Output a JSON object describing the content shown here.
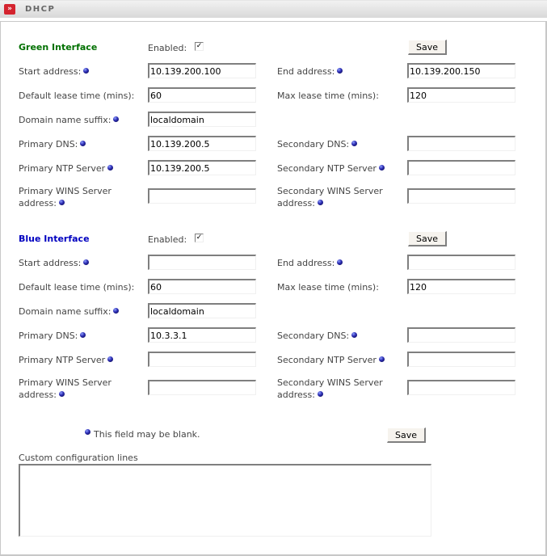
{
  "window": {
    "title": "DHCP",
    "icon": "double-chevron-right-icon"
  },
  "common": {
    "enabled_label": "Enabled:",
    "save_label": "Save"
  },
  "green": {
    "heading": "Green Interface",
    "color": "#007000",
    "enabled": true,
    "start_address": {
      "label": "Start address:",
      "value": "10.139.200.100"
    },
    "end_address": {
      "label": "End address:",
      "value": "10.139.200.150"
    },
    "default_lease": {
      "label": "Default lease time (mins):",
      "value": "60"
    },
    "max_lease": {
      "label": "Max lease time (mins):",
      "value": "120"
    },
    "domain_suffix": {
      "label": "Domain name suffix:",
      "value": "localdomain"
    },
    "primary_dns": {
      "label": "Primary DNS:",
      "value": "10.139.200.5"
    },
    "secondary_dns": {
      "label": "Secondary DNS:",
      "value": ""
    },
    "primary_ntp": {
      "label": "Primary NTP Server",
      "value": "10.139.200.5"
    },
    "secondary_ntp": {
      "label": "Secondary NTP Server",
      "value": ""
    },
    "primary_wins": {
      "label_line1": "Primary WINS Server",
      "label_line2": "address:",
      "value": ""
    },
    "secondary_wins": {
      "label_line1": "Secondary WINS Server",
      "label_line2": "address:",
      "value": ""
    }
  },
  "blue": {
    "heading": "Blue Interface",
    "color": "#0000c0",
    "enabled": true,
    "start_address": {
      "label": "Start address:",
      "value": ""
    },
    "end_address": {
      "label": "End address:",
      "value": ""
    },
    "default_lease": {
      "label": "Default lease time (mins):",
      "value": "60"
    },
    "max_lease": {
      "label": "Max lease time (mins):",
      "value": "120"
    },
    "domain_suffix": {
      "label": "Domain name suffix:",
      "value": "localdomain"
    },
    "primary_dns": {
      "label": "Primary DNS:",
      "value": "10.3.3.1"
    },
    "secondary_dns": {
      "label": "Secondary DNS:",
      "value": ""
    },
    "primary_ntp": {
      "label": "Primary NTP Server",
      "value": ""
    },
    "secondary_ntp": {
      "label": "Secondary NTP Server",
      "value": ""
    },
    "primary_wins": {
      "label_line1": "Primary WINS Server",
      "label_line2": "address:",
      "value": ""
    },
    "secondary_wins": {
      "label_line1": "Secondary WINS Server",
      "label_line2": "address:",
      "value": ""
    }
  },
  "footer": {
    "legend_text": "This field may be blank.",
    "custom_label": "Custom configuration lines",
    "custom_value": ""
  }
}
